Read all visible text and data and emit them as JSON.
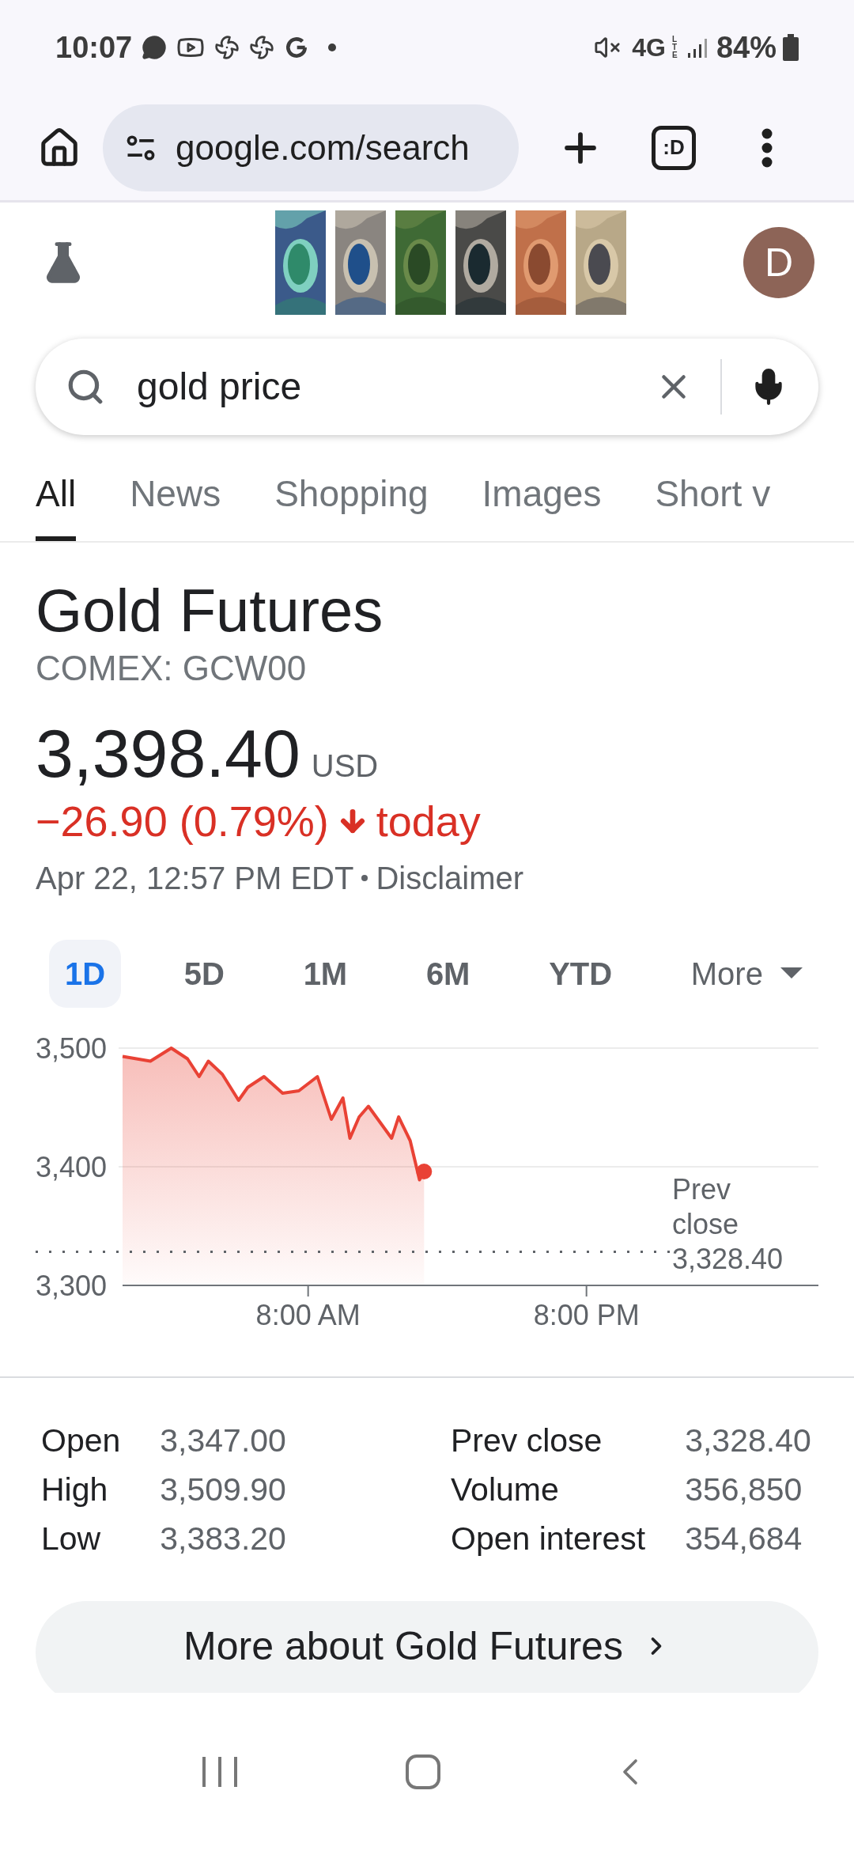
{
  "status_bar": {
    "time": "10:07",
    "network": "4G",
    "network_sub": "LTE",
    "battery": "84%"
  },
  "browser": {
    "url": "google.com/search",
    "tab_count": ":D"
  },
  "header": {
    "avatar_letter": "D"
  },
  "search": {
    "value": "gold price"
  },
  "search_tabs": [
    {
      "label": "All",
      "selected": true
    },
    {
      "label": "News",
      "selected": false
    },
    {
      "label": "Shopping",
      "selected": false
    },
    {
      "label": "Images",
      "selected": false
    },
    {
      "label": "Short v",
      "selected": false
    }
  ],
  "quote": {
    "title": "Gold Futures",
    "ticker": "COMEX: GCW00",
    "price": "3,398.40",
    "currency": "USD",
    "change": "−26.90 (0.79%)",
    "change_suffix": "today",
    "timestamp": "Apr 22, 12:57 PM EDT",
    "disclaimer": "Disclaimer"
  },
  "ranges": [
    {
      "label": "1D",
      "selected": true
    },
    {
      "label": "5D",
      "selected": false
    },
    {
      "label": "1M",
      "selected": false
    },
    {
      "label": "6M",
      "selected": false
    },
    {
      "label": "YTD",
      "selected": false
    },
    {
      "label": "More",
      "selected": false
    }
  ],
  "chart_data": {
    "type": "area",
    "x": [
      0,
      1.2,
      2.1,
      2.8,
      3.3,
      3.7,
      4.3,
      5.0,
      5.4,
      6.1,
      6.9,
      7.6,
      8.4,
      9.0,
      9.5,
      9.8,
      10.2,
      10.6,
      11.6,
      11.9,
      12.4,
      12.8,
      13.0
    ],
    "series": [
      {
        "color": "#e94235",
        "values": [
          3493,
          3489,
          3500,
          3491,
          3476,
          3489,
          3478,
          3456,
          3467,
          3476,
          3462,
          3464,
          3476,
          3440,
          3458,
          3424,
          3442,
          3451,
          3424,
          3442,
          3422,
          3389,
          3396
        ]
      }
    ],
    "xlim": [
      0,
      30
    ],
    "ylim": [
      3300,
      3500
    ],
    "xticks": [
      {
        "value": 8,
        "label": "8:00 AM"
      },
      {
        "value": 20,
        "label": "8:00 PM"
      }
    ],
    "yticks": [
      {
        "value": 3500,
        "label": "3,500"
      },
      {
        "value": 3400,
        "label": "3,400"
      },
      {
        "value": 3300,
        "label": "3,300"
      }
    ],
    "ref_lines": [
      {
        "axis": "y",
        "value": 3328.4,
        "label": "Prev close 3,328.40"
      }
    ]
  },
  "stats": [
    {
      "label": "Open",
      "value": "3,347.00"
    },
    {
      "label": "High",
      "value": "3,509.90"
    },
    {
      "label": "Low",
      "value": "3,383.20"
    },
    {
      "label": "Prev close",
      "value": "3,328.40"
    },
    {
      "label": "Volume",
      "value": "356,850"
    },
    {
      "label": "Open interest",
      "value": "354,684"
    }
  ],
  "more_button": "More about Gold Futures"
}
